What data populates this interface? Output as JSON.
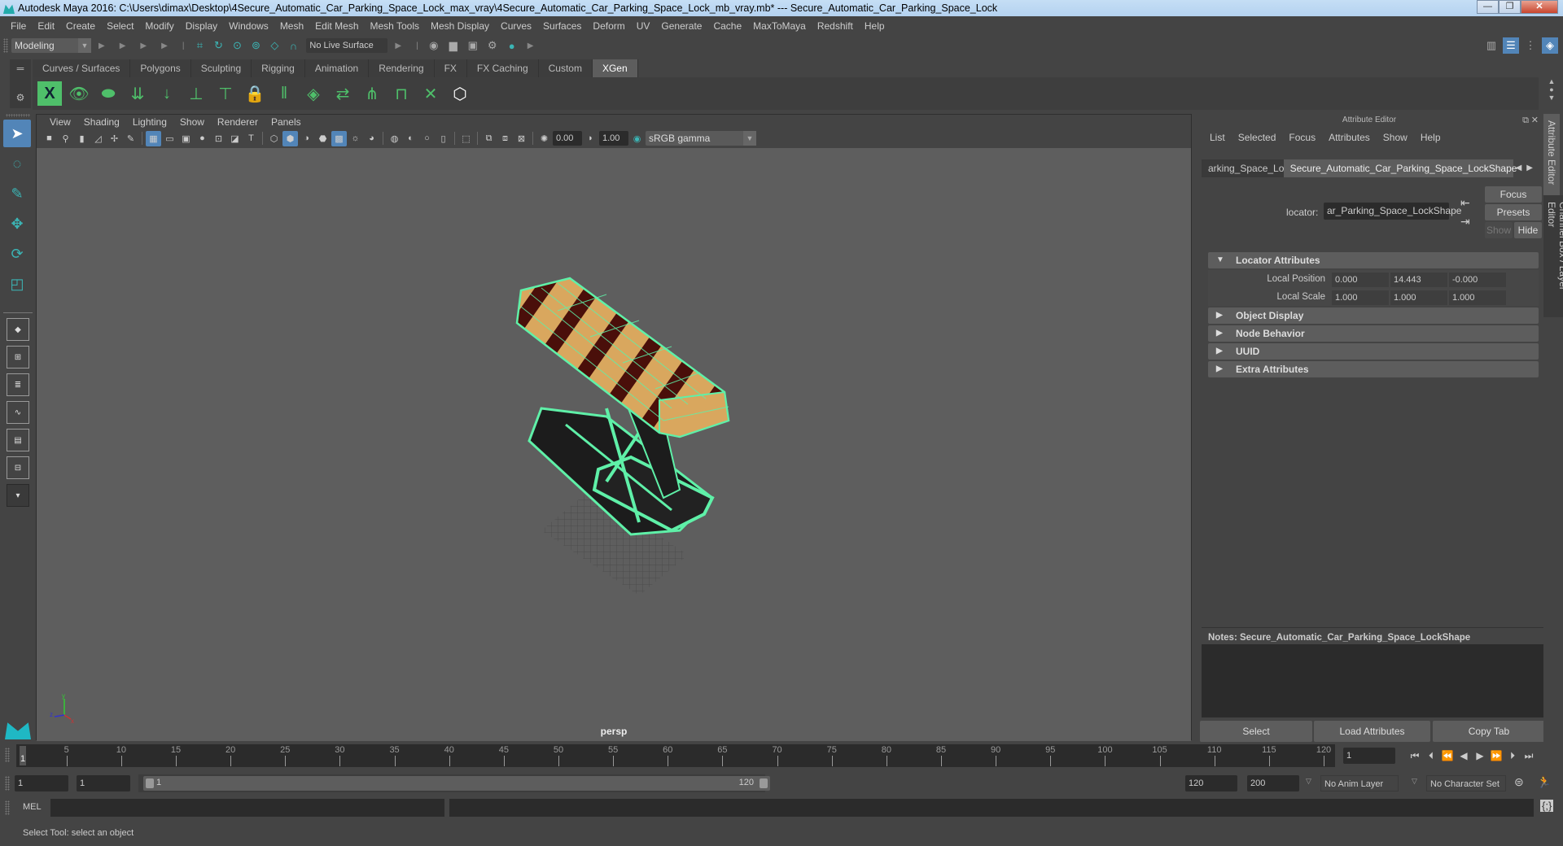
{
  "window": {
    "title": "Autodesk Maya 2016: C:\\Users\\dimax\\Desktop\\4Secure_Automatic_Car_Parking_Space_Lock_max_vray\\4Secure_Automatic_Car_Parking_Space_Lock_mb_vray.mb*   ---   Secure_Automatic_Car_Parking_Space_Lock",
    "minimize": "—",
    "restore": "❐",
    "close": "✕"
  },
  "menubar": [
    "File",
    "Edit",
    "Create",
    "Select",
    "Modify",
    "Display",
    "Windows",
    "Mesh",
    "Edit Mesh",
    "Mesh Tools",
    "Mesh Display",
    "Curves",
    "Surfaces",
    "Deform",
    "UV",
    "Generate",
    "Cache",
    "MaxToMaya",
    "Redshift",
    "Help"
  ],
  "statusline": {
    "mode": "Modeling",
    "live_surface": "No Live Surface",
    "snap_icons": [
      "snap-grid-icon",
      "snap-curve-icon",
      "snap-point-icon",
      "snap-view-plane-icon",
      "snap-live-icon",
      "snap-magnet-icon"
    ],
    "render_icons": [
      "render-view-icon",
      "render-current-icon",
      "ipr-render-icon",
      "render-settings-icon",
      "hypershade-icon"
    ]
  },
  "shelf": {
    "tabs": [
      "Curves / Surfaces",
      "Polygons",
      "Sculpting",
      "Rigging",
      "Animation",
      "Rendering",
      "FX",
      "FX Caching",
      "Custom",
      "XGen"
    ],
    "active_tab": "XGen",
    "icons": [
      "xgen-window-icon",
      "xgen-preview-icon",
      "xgen-clear-preview-icon",
      "add-guides-icon",
      "place-guides-icon",
      "add-guide-icon",
      "guide-visibility-icon",
      "lock-guide-icon",
      "split-guides-icon",
      "ptex-map-icon",
      "guide-to-curve-icon",
      "select-guide-icon",
      "cv-guide-icon",
      "delete-guide-icon",
      "xgen-logo-icon"
    ]
  },
  "toolbox": {
    "tools": [
      "select-tool-icon",
      "lasso-tool-icon",
      "paint-select-icon",
      "move-tool-icon",
      "rotate-tool-icon",
      "scale-tool-icon"
    ],
    "layouts": [
      "single-pane-layout-icon",
      "four-pane-layout-icon",
      "outliner-persp-layout-icon",
      "persp-graph-layout-icon",
      "hypershade-persp-layout-icon",
      "persp-outliner-graph-layout-icon",
      "more-layouts-icon"
    ],
    "logo": "maya-logo-icon"
  },
  "viewport": {
    "menu": [
      "View",
      "Shading",
      "Lighting",
      "Show",
      "Renderer",
      "Panels"
    ],
    "exposure": "0.00",
    "gamma": "1.00",
    "color_space": "sRGB gamma",
    "camera_label": "persp",
    "axis": {
      "x": "x",
      "y": "y",
      "z": "z"
    }
  },
  "attribute_editor": {
    "title": "Attribute Editor",
    "menu": [
      "List",
      "Selected",
      "Focus",
      "Attributes",
      "Show",
      "Help"
    ],
    "tabs": [
      "arking_Space_Lock",
      "Secure_Automatic_Car_Parking_Space_LockShape"
    ],
    "active_tab": "Secure_Automatic_Car_Parking_Space_LockShape",
    "node_type_label": "locator:",
    "node_name": "ar_Parking_Space_LockShape",
    "buttons": {
      "focus": "Focus",
      "presets": "Presets",
      "show": "Show",
      "hide": "Hide"
    },
    "sections": [
      {
        "label": "Locator Attributes",
        "expanded": true
      },
      {
        "label": "Object Display",
        "expanded": false
      },
      {
        "label": "Node Behavior",
        "expanded": false
      },
      {
        "label": "UUID",
        "expanded": false
      },
      {
        "label": "Extra Attributes",
        "expanded": false
      }
    ],
    "attributes": [
      {
        "label": "Local Position",
        "values": [
          "0.000",
          "14.443",
          "-0.000"
        ]
      },
      {
        "label": "Local Scale",
        "values": [
          "1.000",
          "1.000",
          "1.000"
        ]
      }
    ],
    "notes_label": "Notes:  Secure_Automatic_Car_Parking_Space_LockShape",
    "footer": {
      "select": "Select",
      "load": "Load Attributes",
      "copy": "Copy Tab"
    }
  },
  "side_tabs": [
    "Attribute Editor",
    "Channel Box / Layer Editor"
  ],
  "timeline": {
    "start": 1,
    "end": 120,
    "current_frame": "1",
    "ticks": [
      "5",
      "10",
      "15",
      "20",
      "25",
      "30",
      "35",
      "40",
      "45",
      "50",
      "55",
      "60",
      "65",
      "70",
      "75",
      "80",
      "85",
      "90",
      "95",
      "100",
      "105",
      "110",
      "115",
      "120"
    ],
    "current_frame_field": "1"
  },
  "range": {
    "start_field": "1",
    "playback_start": "1",
    "slider_start": "1",
    "slider_end": "120",
    "playback_end": "120",
    "end_field": "200",
    "anim_layer": "No Anim Layer",
    "character_set": "No Character Set"
  },
  "command_line": {
    "label": "MEL",
    "value": ""
  },
  "help_line": "Select Tool: select an object",
  "colors": {
    "wireframe": "#5ff0a8",
    "accent": "#5285b8",
    "body_tan": "#d9a75e",
    "stripe": "#4a0f0a"
  }
}
